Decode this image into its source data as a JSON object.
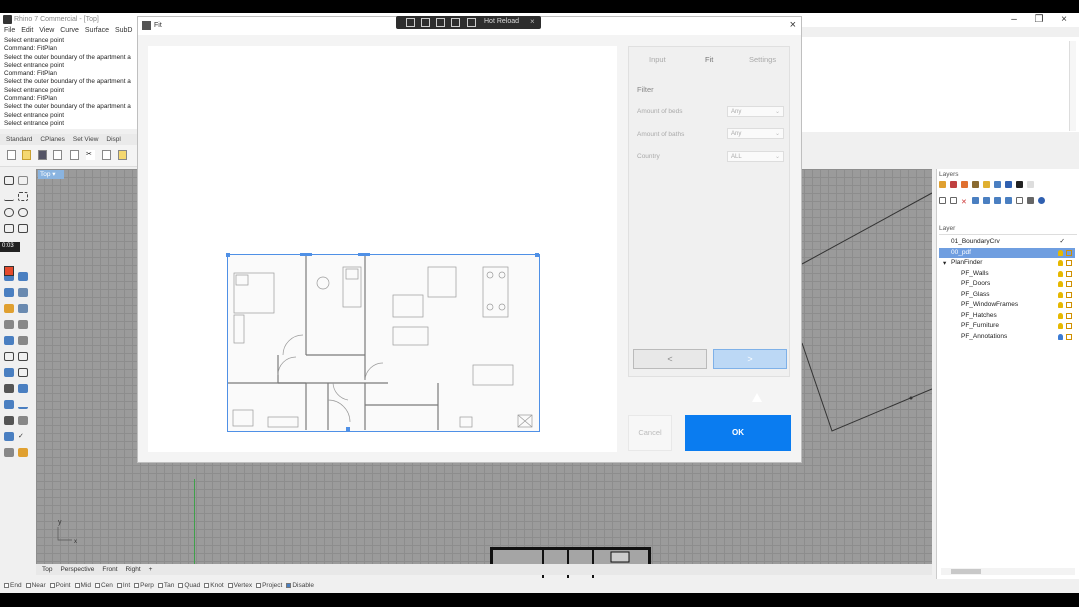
{
  "app": {
    "title": "Rhino 7 Commercial - [Top]",
    "menu": [
      "File",
      "Edit",
      "View",
      "Curve",
      "Surface",
      "SubD"
    ],
    "command_history": [
      "Select entrance point",
      "Command: FitPlan",
      "Select the outer boundary of the apartment a",
      "Select entrance point",
      "Command: FitPlan",
      "Select the outer boundary of the apartment a",
      "Select entrance point",
      "Command: FitPlan",
      "Select the outer boundary of the apartment a",
      "Select entrance point",
      "Select entrance point"
    ],
    "toolbar_tabs": [
      "Standard",
      "CPlanes",
      "Set View",
      "Displ"
    ],
    "viewport_label": "Top",
    "view_tabs": [
      "Top",
      "Perspective",
      "Front",
      "Right",
      "+"
    ],
    "osnaps": [
      {
        "label": "End",
        "on": false
      },
      {
        "label": "Near",
        "on": false
      },
      {
        "label": "Point",
        "on": false
      },
      {
        "label": "Mid",
        "on": false
      },
      {
        "label": "Cen",
        "on": false
      },
      {
        "label": "Int",
        "on": false
      },
      {
        "label": "Perp",
        "on": false
      },
      {
        "label": "Tan",
        "on": false
      },
      {
        "label": "Quad",
        "on": false
      },
      {
        "label": "Knot",
        "on": false
      },
      {
        "label": "Vertex",
        "on": false
      },
      {
        "label": "Project",
        "on": false
      },
      {
        "label": "Disable",
        "on": true
      }
    ],
    "rec_time": "0:03"
  },
  "layers": {
    "panel_title": "Layers",
    "column_header": "Layer",
    "rows": [
      {
        "name": "01_BoundaryCrv",
        "check": "✓"
      },
      {
        "name": "00_pdf",
        "selected": true
      },
      {
        "name": "PlanFinder",
        "expander": "▾"
      },
      {
        "name": "PF_Walls"
      },
      {
        "name": "PF_Doors"
      },
      {
        "name": "PF_Glass"
      },
      {
        "name": "PF_WindowFrames"
      },
      {
        "name": "PF_Hatches"
      },
      {
        "name": "PF_Furniture"
      },
      {
        "name": "PF_Annotations"
      }
    ]
  },
  "hot_reload": {
    "label": "Hot Reload",
    "close": "×"
  },
  "dialog": {
    "title": "Fit",
    "close": "×",
    "tabs": [
      {
        "label": "Input"
      },
      {
        "label": "Fit",
        "active": true
      },
      {
        "label": "Settings"
      }
    ],
    "filter_title": "Filter",
    "filters": [
      {
        "label": "Amount of beds",
        "value": "Any"
      },
      {
        "label": "Amount of baths",
        "value": "Any"
      },
      {
        "label": "Country",
        "value": "ALL"
      }
    ],
    "prev_label": "<",
    "next_label": ">",
    "cancel_label": "Cancel",
    "ok_label": "OK"
  }
}
